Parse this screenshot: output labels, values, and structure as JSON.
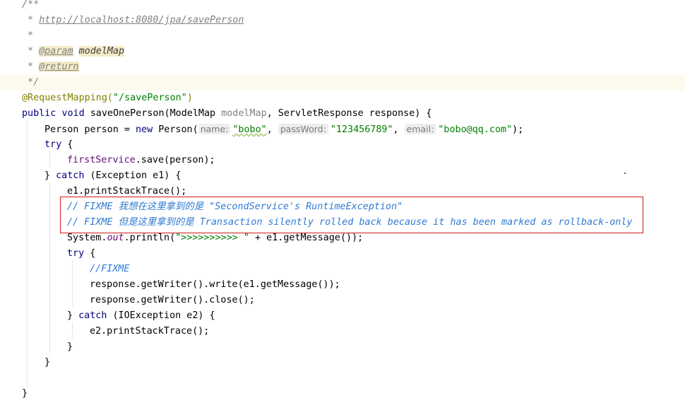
{
  "lines": {
    "l1": "/**",
    "l2_prefix": " * ",
    "l2_link": "http://localhost:8080/jpa/savePerson",
    "l3": " *",
    "l4_prefix": " * ",
    "l4_tag": "@param",
    "l4_name": "modelMap",
    "l5_prefix": " * ",
    "l5_tag": "@return",
    "l6": " */",
    "l7_ann": "@RequestMapping(",
    "l7_str": "\"/savePerson\"",
    "l7_close": ")",
    "l8_kw1": "public void ",
    "l8_text1": "saveOnePerson(ModelMap ",
    "l8_param": "modelMap",
    "l8_text2": ", ServletResponse response) {",
    "l9_text1": "Person person = ",
    "l9_kw": "new ",
    "l9_text2": "Person(",
    "l9_hint1": "name:",
    "l9_str1": "\"bobo\"",
    "l9_sep1": ", ",
    "l9_hint2": "passWord:",
    "l9_str2": "\"123456789\"",
    "l9_sep2": ", ",
    "l9_hint3": "email:",
    "l9_str3": "\"bobo@qq.com\"",
    "l9_close": ");",
    "l10_kw": "try ",
    "l10_text": "{",
    "l11_field": "firstService",
    "l11_text": ".save(person);",
    "l12_text1": "} ",
    "l12_kw": "catch ",
    "l12_text2": "(Exception e1) {",
    "l13": "e1.printStackTrace();",
    "l14": "// FIXME 我想在这里拿到的是 \"SecondService's RuntimeException\"",
    "l15": "// FIXME 但是这里拿到的是 Transaction silently rolled back because it has been marked as rollback-only",
    "l16_text1": "System.",
    "l16_static": "out",
    "l16_text2": ".println(",
    "l16_str": "\">>>>>>>>>> \"",
    "l16_text3": " + e1.getMessage());",
    "l17_kw": "try ",
    "l17_text": "{",
    "l18": "//FIXME",
    "l19": "response.getWriter().write(e1.getMessage());",
    "l20": "response.getWriter().close();",
    "l21_text1": "} ",
    "l21_kw": "catch ",
    "l21_text2": "(IOException e2) {",
    "l22": "e2.printStackTrace();",
    "l23": "}",
    "l24": "}",
    "l26": "}"
  },
  "colors": {
    "comment": "#808080",
    "annotation": "#808000",
    "string": "#008000",
    "keyword": "#000080",
    "field": "#660e7a",
    "fixme": "#2e7ad4",
    "highlight_box": "#cc1b1b",
    "current_line": "#fcfaed"
  }
}
